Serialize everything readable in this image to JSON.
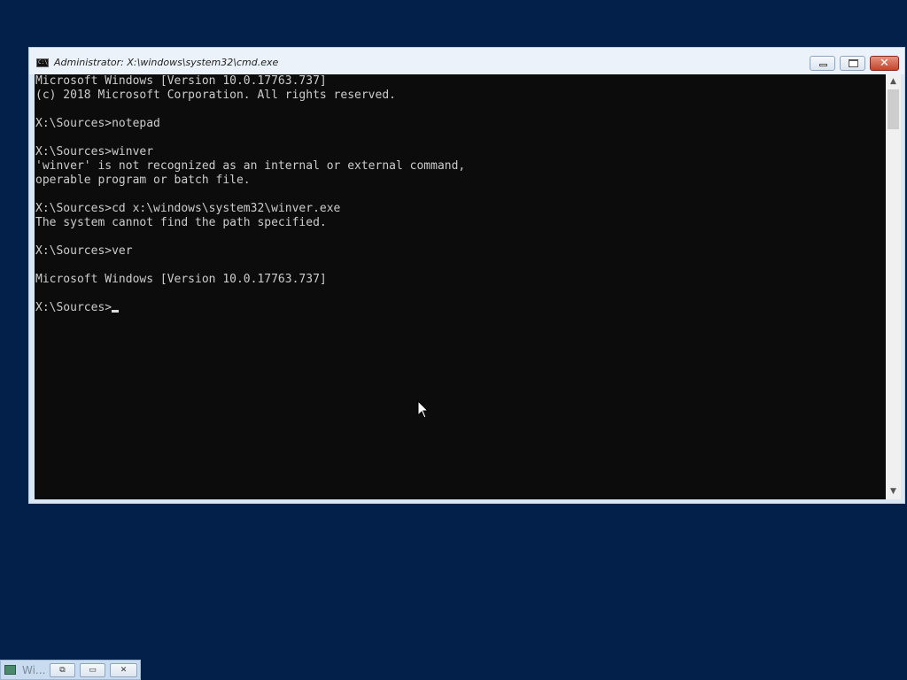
{
  "window": {
    "title": "Administrator: X:\\windows\\system32\\cmd.exe",
    "icon_label": "C:\\"
  },
  "console": {
    "lines": [
      "Microsoft Windows [Version 10.0.17763.737]",
      "(c) 2018 Microsoft Corporation. All rights reserved.",
      "",
      "X:\\Sources>notepad",
      "",
      "X:\\Sources>winver",
      "'winver' is not recognized as an internal or external command,",
      "operable program or batch file.",
      "",
      "X:\\Sources>cd x:\\windows\\system32\\winver.exe",
      "The system cannot find the path specified.",
      "",
      "X:\\Sources>ver",
      "",
      "Microsoft Windows [Version 10.0.17763.737]",
      ""
    ],
    "prompt": "X:\\Sources>"
  },
  "taskbar_minimized": {
    "label": "Wi..."
  },
  "icons": {
    "app": "cmd-icon",
    "minimize": "minimize-icon",
    "maximize": "maximize-icon",
    "close": "close-icon",
    "scroll_up": "chevron-up-icon",
    "scroll_down": "chevron-down-icon",
    "cursor": "mouse-pointer-icon"
  },
  "colors": {
    "desktop": "#02204a",
    "console_bg": "#0c0c0c",
    "console_fg": "#cccccc",
    "close_button": "#c3452c"
  }
}
